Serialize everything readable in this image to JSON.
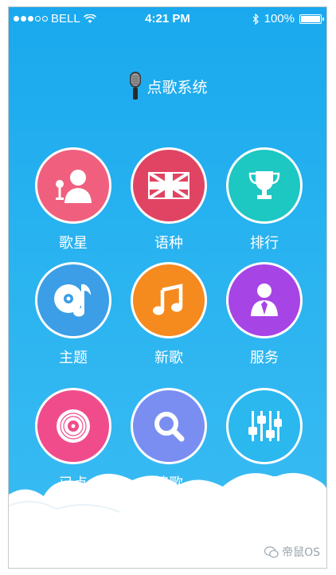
{
  "status_bar": {
    "carrier": "BELL",
    "time": "4:21 PM",
    "battery": "100%"
  },
  "header": {
    "title": "点歌系统"
  },
  "menu": [
    {
      "id": "singer",
      "label": "歌星",
      "color": "#f0607e"
    },
    {
      "id": "language",
      "label": "语种",
      "color": "#e14463"
    },
    {
      "id": "ranking",
      "label": "排行",
      "color": "#1dc7c2"
    },
    {
      "id": "theme",
      "label": "主题",
      "color": "#3b9ee6"
    },
    {
      "id": "new-songs",
      "label": "新歌",
      "color": "#f58a1f"
    },
    {
      "id": "service",
      "label": "服务",
      "color": "#a744e6"
    },
    {
      "id": "selected",
      "label": "已点",
      "color": "#f04c8c"
    },
    {
      "id": "search-song",
      "label": "搜歌",
      "color": "#7a8ef1"
    },
    {
      "id": "settings",
      "label": "设置",
      "color": "#2bb8ee"
    }
  ],
  "watermark": {
    "text": "帝鼠OS"
  },
  "icons": {
    "singer": "singer-microphone-icon",
    "language": "uk-flag-icon",
    "ranking": "trophy-icon",
    "theme": "music-disc-icon",
    "new-songs": "music-note-icon",
    "service": "waiter-icon",
    "selected": "vinyl-disc-icon",
    "search-song": "magnifier-icon",
    "settings": "sliders-icon"
  }
}
